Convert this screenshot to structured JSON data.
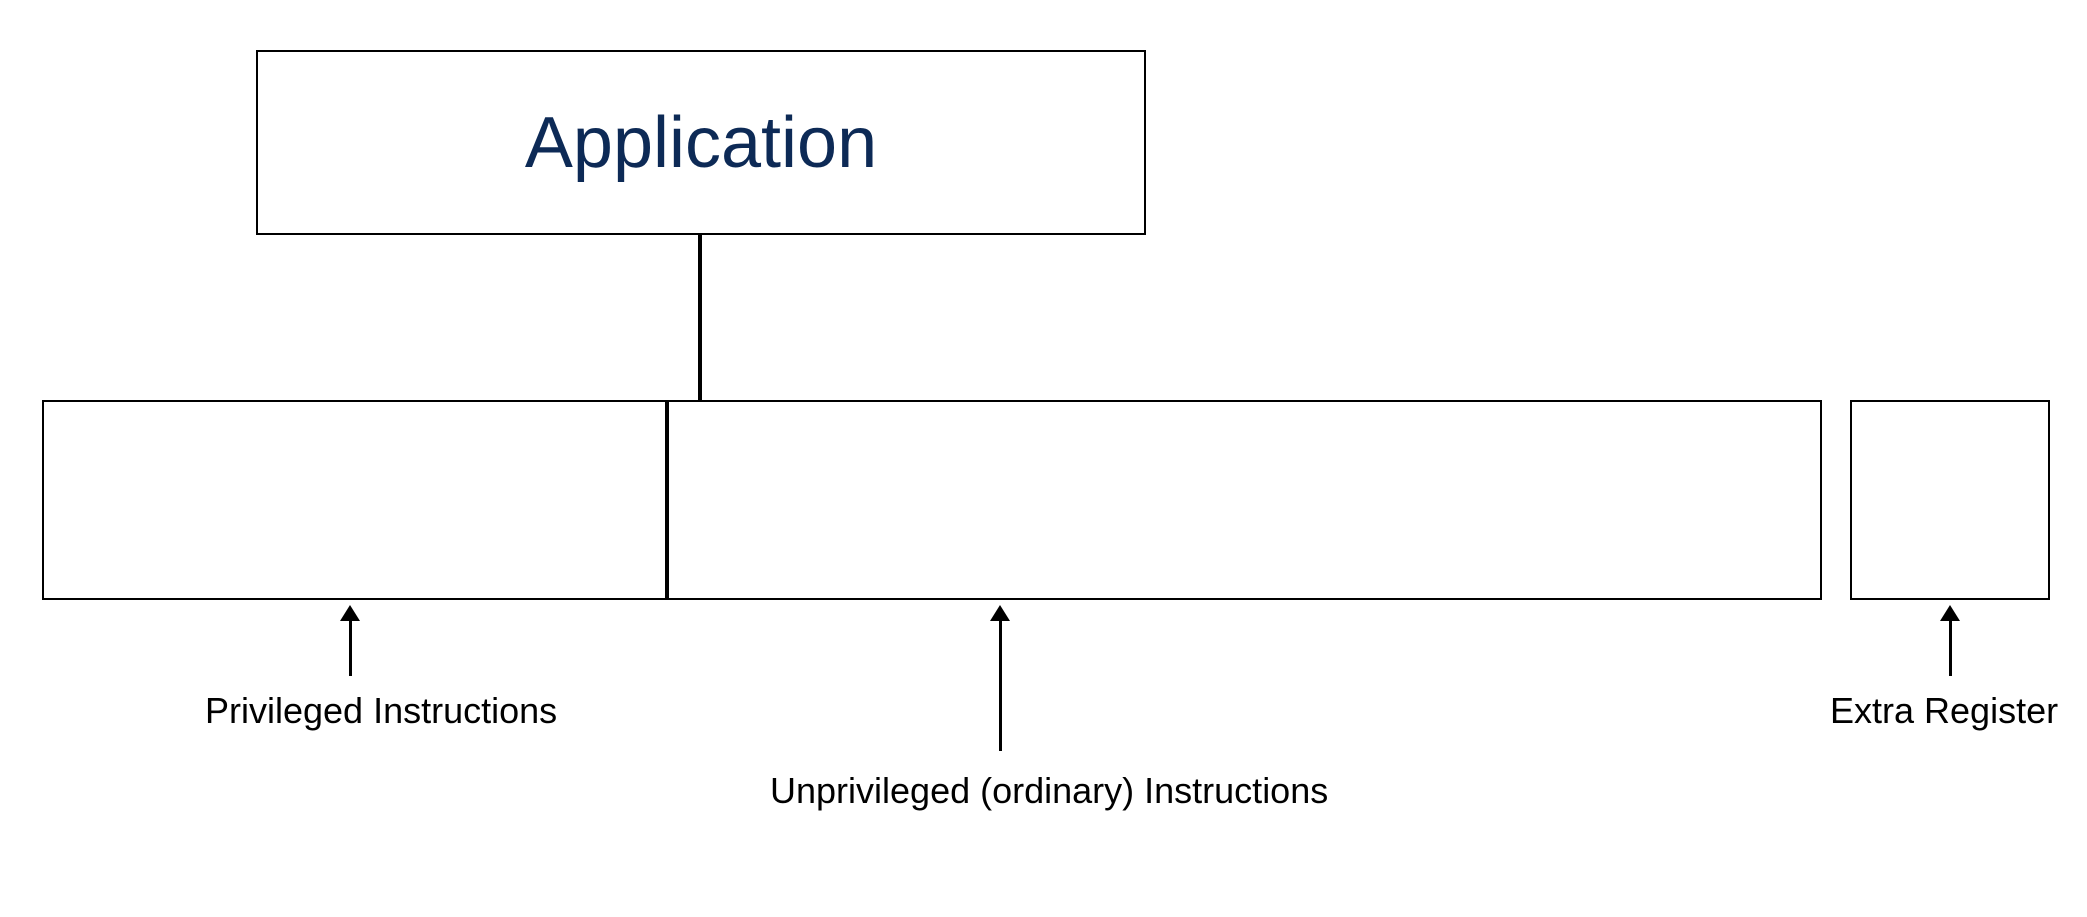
{
  "diagram": {
    "application": {
      "label": "Application"
    },
    "annotations": {
      "privileged": "Privileged Instructions",
      "unprivileged": "Unprivileged (ordinary) Instructions",
      "extra": "Extra Register"
    }
  }
}
